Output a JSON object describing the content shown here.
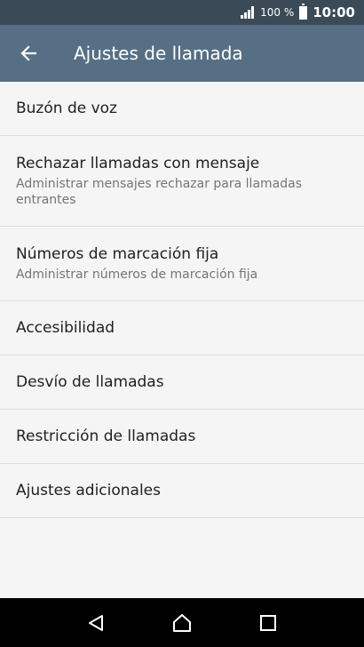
{
  "status_bar": {
    "battery_percent": "100 %",
    "time": "10:00",
    "signal_icon": "signal-icon",
    "battery_icon": "battery-icon"
  },
  "app_bar": {
    "title": "Ajustes de llamada",
    "back_icon": "back-arrow-icon"
  },
  "list": {
    "items": [
      {
        "primary": "Buzón de voz"
      },
      {
        "primary": "Rechazar llamadas con mensaje",
        "secondary": "Administrar mensajes rechazar para llamadas entrantes"
      },
      {
        "primary": "Números de marcación fija",
        "secondary": "Administrar números de marcación fija"
      },
      {
        "primary": "Accesibilidad"
      },
      {
        "primary": "Desvío de llamadas"
      },
      {
        "primary": "Restricción de llamadas"
      },
      {
        "primary": "Ajustes adicionales"
      }
    ]
  },
  "nav_bar": {
    "back_icon": "nav-back-icon",
    "home_icon": "nav-home-icon",
    "recents_icon": "nav-recents-icon"
  },
  "colors": {
    "status_bar": "#3a4a56",
    "app_bar": "#566f84",
    "background": "#f5f5f5",
    "nav_bar": "#000000"
  }
}
